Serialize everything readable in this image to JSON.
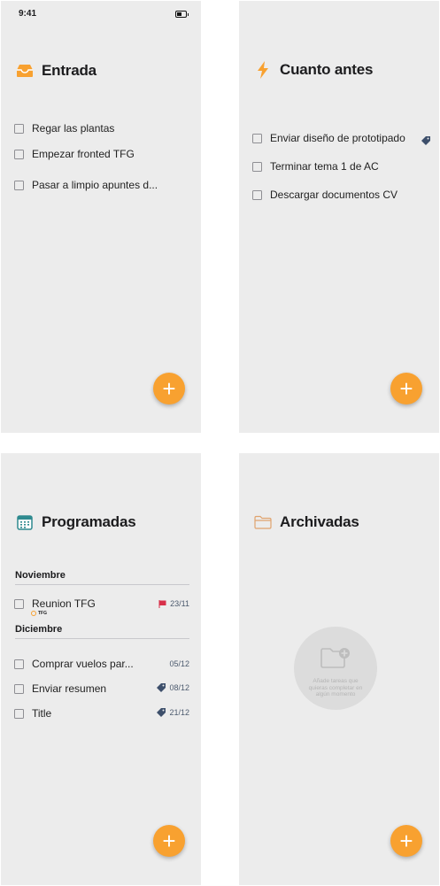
{
  "status": {
    "time": "9:41"
  },
  "screens": {
    "entrada": {
      "title": "Entrada",
      "tasks": [
        "Regar las plantas",
        "Empezar fronted TFG",
        "Pasar a limpio apuntes d..."
      ]
    },
    "cuanto_antes": {
      "title": "Cuanto antes",
      "tasks": [
        "Enviar diseño de prototipado",
        "Terminar tema 1 de AC",
        "Descargar documentos CV"
      ]
    },
    "programadas": {
      "title": "Programadas",
      "sections": [
        {
          "label": "Noviembre",
          "tasks": [
            {
              "name": "Reunion TFG",
              "date": "23/11",
              "tag": "TFG",
              "marker": "flag"
            }
          ]
        },
        {
          "label": "Diciembre",
          "tasks": [
            {
              "name": "Comprar vuelos par...",
              "date": "05/12",
              "marker": "none"
            },
            {
              "name": "Enviar resumen",
              "date": "08/12",
              "marker": "tag"
            },
            {
              "name": "Title",
              "date": "21/12",
              "marker": "tag"
            }
          ]
        }
      ]
    },
    "archivadas": {
      "title": "Archivadas",
      "empty_text": "Añade tareas que quieras completar en algún momento"
    }
  },
  "fab_label": "+",
  "colors": {
    "accent": "#f8a130",
    "flag": "#d8304a",
    "tag": "#3d4f6b",
    "calendar": "#2e8a8f",
    "background": "#ececec"
  }
}
